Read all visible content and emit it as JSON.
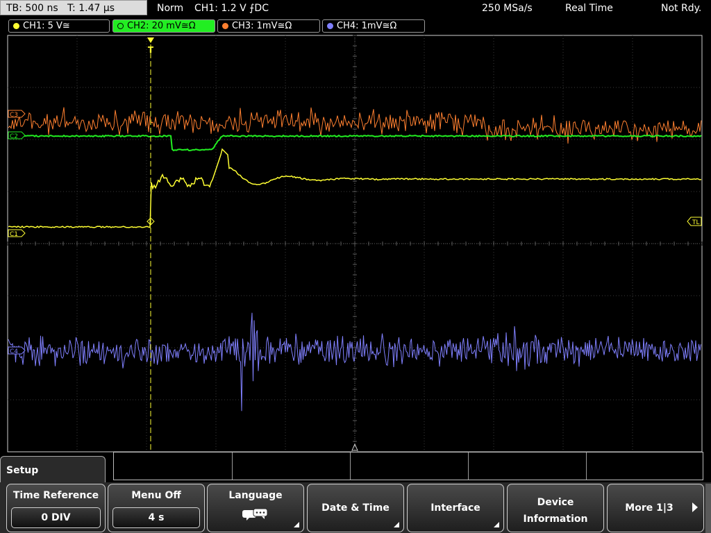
{
  "status": {
    "timebase": "TB: 500 ns",
    "trigger_time": "T: 1.47 µs",
    "mode": "Norm",
    "trigger_info": "CH1: 1.2 V ⨍DC",
    "sample_rate": "250 MSa/s",
    "acq_mode": "Real Time",
    "state": "Not Rdy."
  },
  "channels": [
    {
      "label": "CH1: 5 V≅",
      "color": "#ffff33",
      "active": false
    },
    {
      "label": "CH2: 20 mV≅Ω",
      "color": "#22ee22",
      "active": true
    },
    {
      "label": "CH3: 1mV≅Ω",
      "color": "#ff8030",
      "active": false
    },
    {
      "label": "CH4: 1mV≅Ω",
      "color": "#8080ff",
      "active": false
    }
  ],
  "markers": {
    "c3": "C3",
    "c2": "C2",
    "c1": "C1",
    "c4": "C4",
    "trigger_level": "TL",
    "trigger_pos": "T"
  },
  "traces": [
    {
      "name": "CH1",
      "description": "step response",
      "color": "#ffff33"
    },
    {
      "name": "CH2",
      "description": "dip",
      "color": "#22ee22"
    },
    {
      "name": "CH3",
      "description": "noise",
      "color": "#ff8030"
    },
    {
      "name": "CH4",
      "description": "noise with burst",
      "color": "#8080ff"
    }
  ],
  "menu": {
    "setup_title": "Setup",
    "time_reference": {
      "label": "Time Reference",
      "value": "0 DIV"
    },
    "menu_off": {
      "label": "Menu Off",
      "value": "4 s"
    },
    "language": {
      "label": "Language"
    },
    "date_time": {
      "label": "Date & Time"
    },
    "interface": {
      "label": "Interface"
    },
    "device_info": {
      "line1": "Device",
      "line2": "Information"
    },
    "more": {
      "label": "More 1|3"
    }
  }
}
